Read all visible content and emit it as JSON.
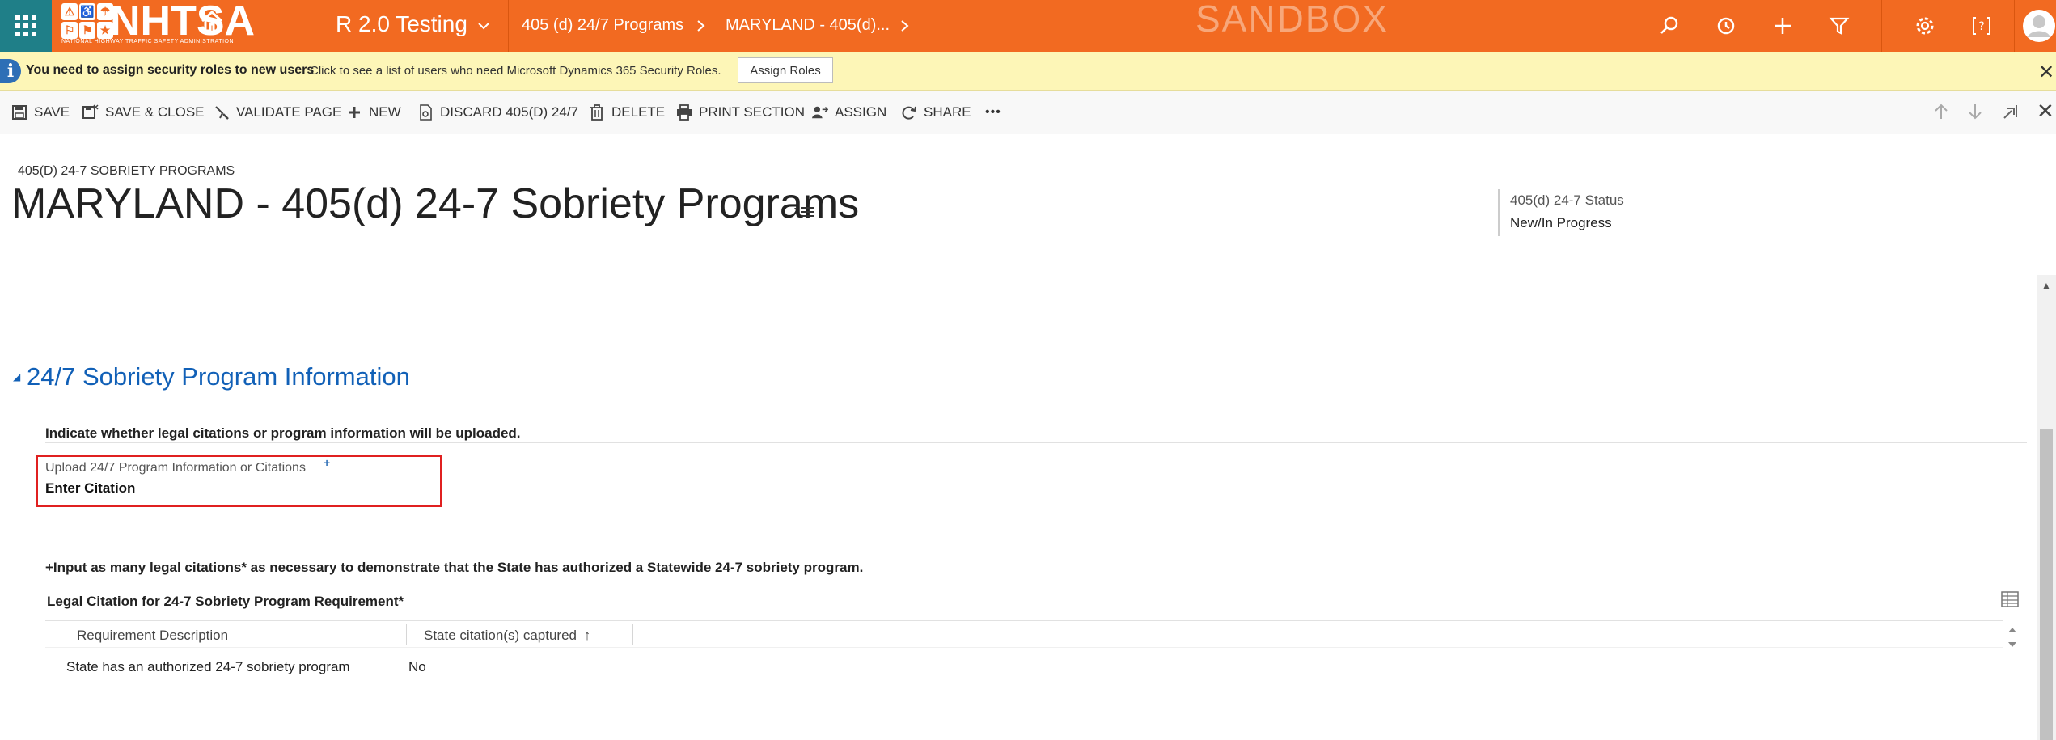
{
  "nav": {
    "logo_text": "NHTSA",
    "logo_subtitle": "NATIONAL HIGHWAY TRAFFIC SAFETY ADMINISTRATION",
    "app_name": "R 2.0 Testing",
    "breadcrumb": [
      "405 (d) 24/7 Programs",
      "MARYLAND - 405(d)..."
    ],
    "environment_label": "SANDBOX",
    "icons": [
      "search-icon",
      "recent-icon",
      "plus-icon",
      "filter-icon",
      "gear-icon",
      "help-icon",
      "user-avatar"
    ]
  },
  "notification": {
    "title": "You need to assign security roles to new users",
    "message": "Click to see a list of users who need Microsoft Dynamics 365 Security Roles.",
    "button_label": "Assign Roles"
  },
  "commands": {
    "save": "SAVE",
    "save_close": "SAVE & CLOSE",
    "validate": "VALIDATE PAGE",
    "new": "NEW",
    "discard": "DISCARD 405(D) 24/7",
    "delete": "DELETE",
    "print": "PRINT SECTION",
    "assign": "ASSIGN",
    "share": "SHARE",
    "more": "•••"
  },
  "header": {
    "entity_type": "405(D) 24-7 SOBRIETY PROGRAMS",
    "title": "MARYLAND - 405(d) 24-7 Sobriety Programs",
    "status_label": "405(d) 24-7 Status",
    "status_value": "New/In Progress"
  },
  "section": {
    "title": "24/7 Sobriety Program Information",
    "instruction": "Indicate whether legal citations or program information will be uploaded.",
    "field_label": "Upload 24/7 Program Information or Citations",
    "field_required_marker": "+",
    "field_value": "Enter Citation",
    "input_instruction": "+Input as many legal citations* as necessary to demonstrate that the State has authorized a Statewide 24-7 sobriety program."
  },
  "subgrid": {
    "title": "Legal Citation for 24-7 Sobriety Program Requirement*",
    "columns": [
      "Requirement Description",
      "State citation(s) captured"
    ],
    "sort_indicator": "↑",
    "rows": [
      [
        "State has an authorized 24-7 sobriety program",
        "No"
      ]
    ]
  }
}
